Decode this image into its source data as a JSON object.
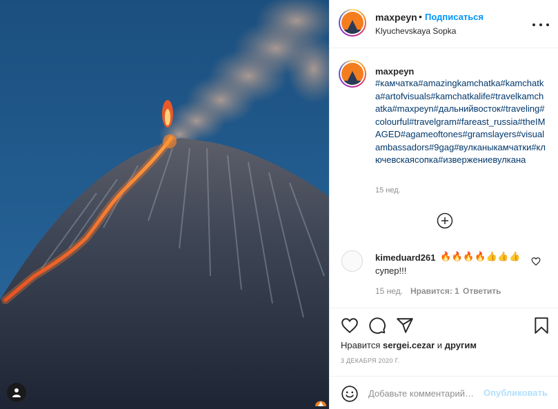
{
  "post": {
    "username": "maxpeyn",
    "follow_label": "Подписаться",
    "location": "Klyuchevskaya Sopka",
    "caption_username": "maxpeyn",
    "caption": "#камчатка#amazingkamchatka#kamchatka#artofvisuals#kamchatkalife#travelkamchatka#maxpeyn#дальнийвосток#traveling#colourful#travelgram#fareast_russia#theIMAGED#agameoftones#gramslayers#visualambassadors#9gag#вулканыкамчатки#ключевскаясопка#извержениевулкана",
    "caption_time": "15 нед."
  },
  "comment": {
    "username": "kimeduard261",
    "emoji": "🔥🔥🔥🔥👍👍👍",
    "text": "супер!!!",
    "time": "15 нед.",
    "likes": "Нравится: 1",
    "reply": "Ответить"
  },
  "likes": {
    "prefix": "Нравится",
    "user": "sergei.cezar",
    "conj": "и",
    "others": "другим"
  },
  "date": "3 ДЕКАБРЯ 2020 Г.",
  "comment_input": {
    "placeholder": "Добавьте комментарий…",
    "post_label": "Опубликовать"
  },
  "icons": {
    "photo_user_tag": "user-icon",
    "more": "more-horizontal-icon",
    "load_more": "plus-circle-icon",
    "comment_like": "heart-icon",
    "like": "heart-icon",
    "comment": "comment-icon",
    "share": "paper-plane-icon",
    "save": "bookmark-icon",
    "emoji": "smiley-icon"
  },
  "colors": {
    "link": "#0095f6",
    "hashtag": "#00376b",
    "muted": "#8e8e8e",
    "post_disabled": "#b2dffc"
  }
}
